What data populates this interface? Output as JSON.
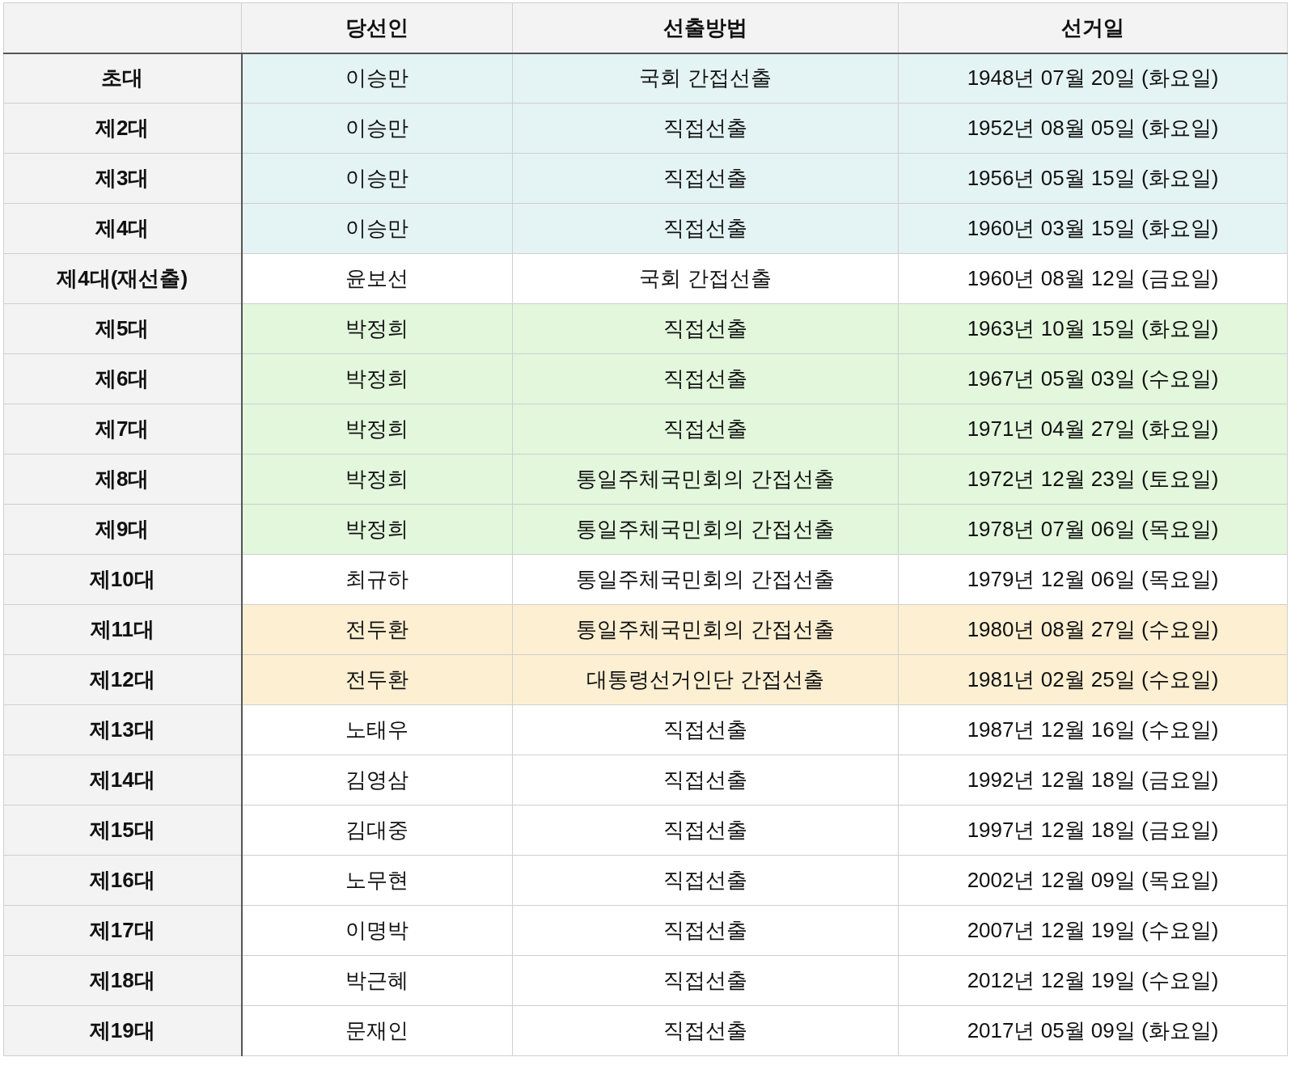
{
  "table": {
    "columns": [
      "당선인",
      "선출방법",
      "선거일"
    ],
    "rows": [
      {
        "term": "초대",
        "winner": "이승만",
        "method": "국회 간접선출",
        "date": "1948년 07월 20일 (화요일)",
        "color": "#e4f3f3"
      },
      {
        "term": "제2대",
        "winner": "이승만",
        "method": "직접선출",
        "date": "1952년 08월 05일 (화요일)",
        "color": "#e4f3f3"
      },
      {
        "term": "제3대",
        "winner": "이승만",
        "method": "직접선출",
        "date": "1956년 05월 15일 (화요일)",
        "color": "#e4f3f3"
      },
      {
        "term": "제4대",
        "winner": "이승만",
        "method": "직접선출",
        "date": "1960년 03월 15일 (화요일)",
        "color": "#e4f3f3"
      },
      {
        "term": "제4대(재선출)",
        "winner": "윤보선",
        "method": "국회 간접선출",
        "date": "1960년 08월 12일 (금요일)",
        "color": "#ffffff"
      },
      {
        "term": "제5대",
        "winner": "박정희",
        "method": "직접선출",
        "date": "1963년 10월 15일 (화요일)",
        "color": "#e2f7dc"
      },
      {
        "term": "제6대",
        "winner": "박정희",
        "method": "직접선출",
        "date": "1967년 05월 03일 (수요일)",
        "color": "#e2f7dc"
      },
      {
        "term": "제7대",
        "winner": "박정희",
        "method": "직접선출",
        "date": "1971년 04월 27일 (화요일)",
        "color": "#e2f7dc"
      },
      {
        "term": "제8대",
        "winner": "박정희",
        "method": "통일주체국민회의 간접선출",
        "date": "1972년 12월 23일 (토요일)",
        "color": "#e2f7dc"
      },
      {
        "term": "제9대",
        "winner": "박정희",
        "method": "통일주체국민회의 간접선출",
        "date": "1978년 07월 06일 (목요일)",
        "color": "#e2f7dc"
      },
      {
        "term": "제10대",
        "winner": "최규하",
        "method": "통일주체국민회의 간접선출",
        "date": "1979년 12월 06일 (목요일)",
        "color": "#ffffff"
      },
      {
        "term": "제11대",
        "winner": "전두환",
        "method": "통일주체국민회의 간접선출",
        "date": "1980년 08월 27일 (수요일)",
        "color": "#fcefd2"
      },
      {
        "term": "제12대",
        "winner": "전두환",
        "method": "대통령선거인단 간접선출",
        "date": "1981년 02월 25일 (수요일)",
        "color": "#fcefd2"
      },
      {
        "term": "제13대",
        "winner": "노태우",
        "method": "직접선출",
        "date": "1987년 12월 16일 (수요일)",
        "color": "#ffffff"
      },
      {
        "term": "제14대",
        "winner": "김영삼",
        "method": "직접선출",
        "date": "1992년 12월 18일 (금요일)",
        "color": "#ffffff"
      },
      {
        "term": "제15대",
        "winner": "김대중",
        "method": "직접선출",
        "date": "1997년 12월 18일 (금요일)",
        "color": "#ffffff"
      },
      {
        "term": "제16대",
        "winner": "노무현",
        "method": "직접선출",
        "date": "2002년 12월 09일 (목요일)",
        "color": "#ffffff"
      },
      {
        "term": "제17대",
        "winner": "이명박",
        "method": "직접선출",
        "date": "2007년 12월 19일 (수요일)",
        "color": "#ffffff"
      },
      {
        "term": "제18대",
        "winner": "박근혜",
        "method": "직접선출",
        "date": "2012년 12월 19일 (수요일)",
        "color": "#ffffff"
      },
      {
        "term": "제19대",
        "winner": "문재인",
        "method": "직접선출",
        "date": "2017년 05월 09일 (화요일)",
        "color": "#ffffff"
      }
    ]
  }
}
